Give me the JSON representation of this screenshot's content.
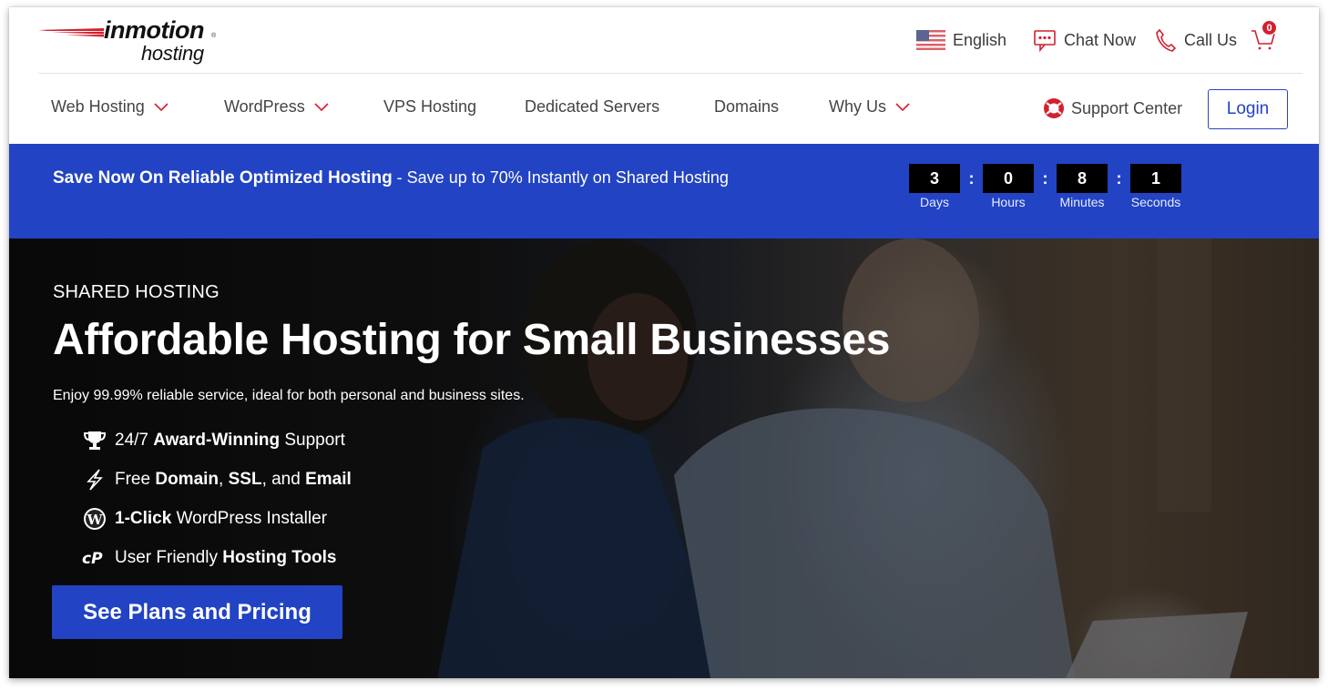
{
  "brand": {
    "name": "inmotion",
    "tagline": "hosting",
    "registered_mark": "®",
    "accent_red": "#d2202f",
    "brand_blue": "#2243c3"
  },
  "utility_bar": {
    "language": {
      "label": "English",
      "icon": "us-flag-icon"
    },
    "chat": {
      "label": "Chat Now",
      "icon": "chat-bubble-icon"
    },
    "call": {
      "label": "Call Us",
      "icon": "phone-icon"
    },
    "cart": {
      "count": "0",
      "icon": "cart-icon"
    }
  },
  "nav": {
    "items": [
      {
        "label": "Web Hosting",
        "has_dropdown": true
      },
      {
        "label": "WordPress",
        "has_dropdown": true
      },
      {
        "label": "VPS Hosting",
        "has_dropdown": false
      },
      {
        "label": "Dedicated Servers",
        "has_dropdown": false
      },
      {
        "label": "Domains",
        "has_dropdown": false
      },
      {
        "label": "Why Us",
        "has_dropdown": true
      }
    ],
    "support": {
      "label": "Support Center",
      "icon": "lifebuoy-icon"
    },
    "login_label": "Login"
  },
  "promo": {
    "headline": "Save Now On Reliable Optimized Hosting",
    "detail": " - Save up to 70% Instantly on Shared Hosting",
    "countdown": [
      {
        "value": "3",
        "label": "Days"
      },
      {
        "value": "0",
        "label": "Hours"
      },
      {
        "value": "8",
        "label": "Minutes"
      },
      {
        "value": "1",
        "label": "Seconds"
      }
    ],
    "separator": ":"
  },
  "hero": {
    "kicker": "SHARED HOSTING",
    "title": "Affordable Hosting for Small Businesses",
    "subtitle": "Enjoy 99.99% reliable service, ideal for both personal and business sites.",
    "features": [
      {
        "icon": "trophy-icon",
        "parts": [
          {
            "t": "24/7 ",
            "b": false
          },
          {
            "t": "Award-Winning",
            "b": true
          },
          {
            "t": " Support",
            "b": false
          }
        ]
      },
      {
        "icon": "lightning-icon",
        "parts": [
          {
            "t": "Free ",
            "b": false
          },
          {
            "t": "Domain",
            "b": true
          },
          {
            "t": ", ",
            "b": false
          },
          {
            "t": "SSL",
            "b": true
          },
          {
            "t": ", and ",
            "b": false
          },
          {
            "t": "Email",
            "b": true
          }
        ]
      },
      {
        "icon": "wordpress-icon",
        "parts": [
          {
            "t": "1-Click",
            "b": true
          },
          {
            "t": " WordPress Installer",
            "b": false
          }
        ]
      },
      {
        "icon": "cpanel-icon",
        "parts": [
          {
            "t": "User Friendly ",
            "b": false
          },
          {
            "t": "Hosting Tools",
            "b": true
          }
        ]
      }
    ],
    "cta_label": "See Plans and Pricing"
  }
}
